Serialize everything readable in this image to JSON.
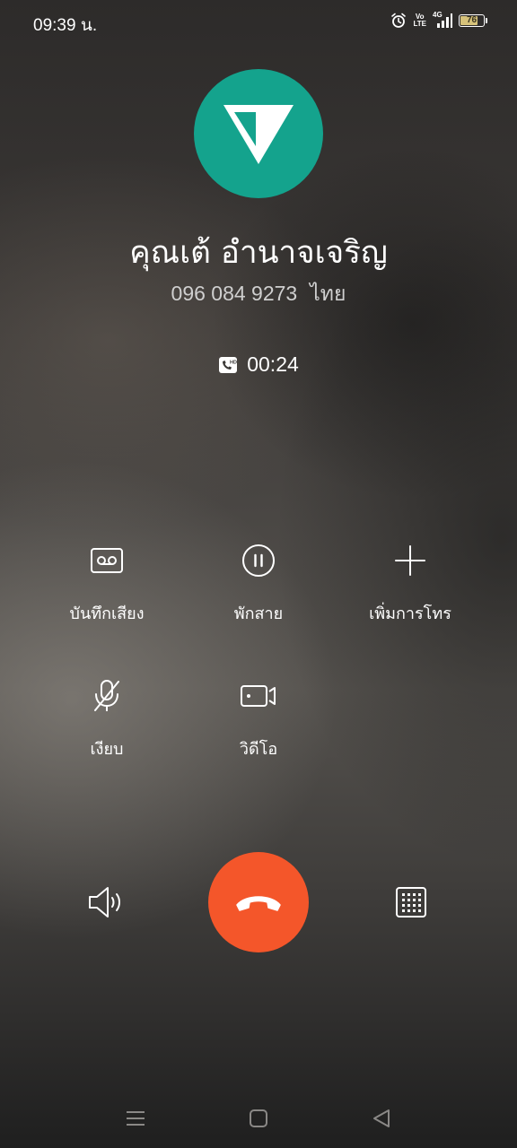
{
  "status_bar": {
    "time": "09:39 น.",
    "volte_top": "Vo",
    "volte_bottom": "LTE",
    "network": "4G",
    "battery_level": "76",
    "battery_fraction": 0.76,
    "icons": [
      "alarm-icon",
      "volte-icon",
      "signal-icon",
      "battery-icon"
    ]
  },
  "contact": {
    "avatar_color": "#14a38d",
    "name": "คุณเต้ อำนาจเจริญ",
    "number": "096 084 9273",
    "location": "ไทย"
  },
  "call": {
    "timer": "00:24",
    "hd_icon": "hd-call-icon"
  },
  "actions": [
    {
      "label": "บันทึกเสียง",
      "icon": "record-icon"
    },
    {
      "label": "พักสาย",
      "icon": "pause-icon"
    },
    {
      "label": "เพิ่มการโทร",
      "icon": "add-call-icon"
    },
    {
      "label": "เงียบ",
      "icon": "mute-icon"
    },
    {
      "label": "วิดีโอ",
      "icon": "video-icon"
    }
  ],
  "controls": {
    "speaker_icon": "speaker-icon",
    "end_call_icon": "end-call-icon",
    "end_call_color": "#f4562a",
    "keypad_icon": "keypad-icon"
  },
  "nav": [
    "menu-icon",
    "home-icon",
    "back-icon"
  ]
}
